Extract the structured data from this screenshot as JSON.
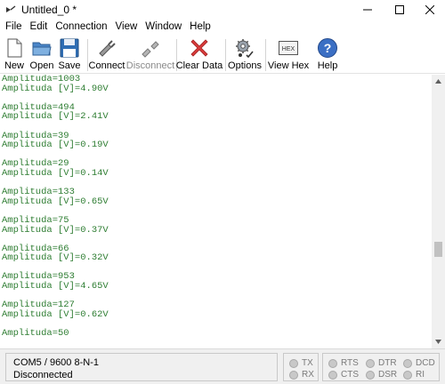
{
  "window": {
    "title": "Untitled_0 *"
  },
  "menu": [
    "File",
    "Edit",
    "Connection",
    "View",
    "Window",
    "Help"
  ],
  "toolbar": {
    "new": "New",
    "open": "Open",
    "save": "Save",
    "connect": "Connect",
    "disconnect": "Disconnect",
    "clear": "Clear Data",
    "options": "Options",
    "viewhex": "View Hex",
    "hex_icon_text": "HEX",
    "help": "Help"
  },
  "terminal": {
    "lines": [
      "Amplituda=1003",
      "Amplituda [V]=4.90V",
      "",
      "Amplituda=494",
      "Amplituda [V]=2.41V",
      "",
      "Amplituda=39",
      "Amplituda [V]=0.19V",
      "",
      "Amplituda=29",
      "Amplituda [V]=0.14V",
      "",
      "Amplituda=133",
      "Amplituda [V]=0.65V",
      "",
      "Amplituda=75",
      "Amplituda [V]=0.37V",
      "",
      "Amplituda=66",
      "Amplituda [V]=0.32V",
      "",
      "Amplituda=953",
      "Amplituda [V]=4.65V",
      "",
      "Amplituda=127",
      "Amplituda [V]=0.62V",
      "",
      "Amplituda=50"
    ],
    "color": "#2e7d32"
  },
  "status": {
    "port": "COM5 / 9600 8-N-1",
    "connection": "Disconnected",
    "signals": {
      "tx": "TX",
      "rx": "RX",
      "rts": "RTS",
      "cts": "CTS",
      "dtr": "DTR",
      "dsr": "DSR",
      "dcd": "DCD",
      "ri": "RI"
    }
  }
}
